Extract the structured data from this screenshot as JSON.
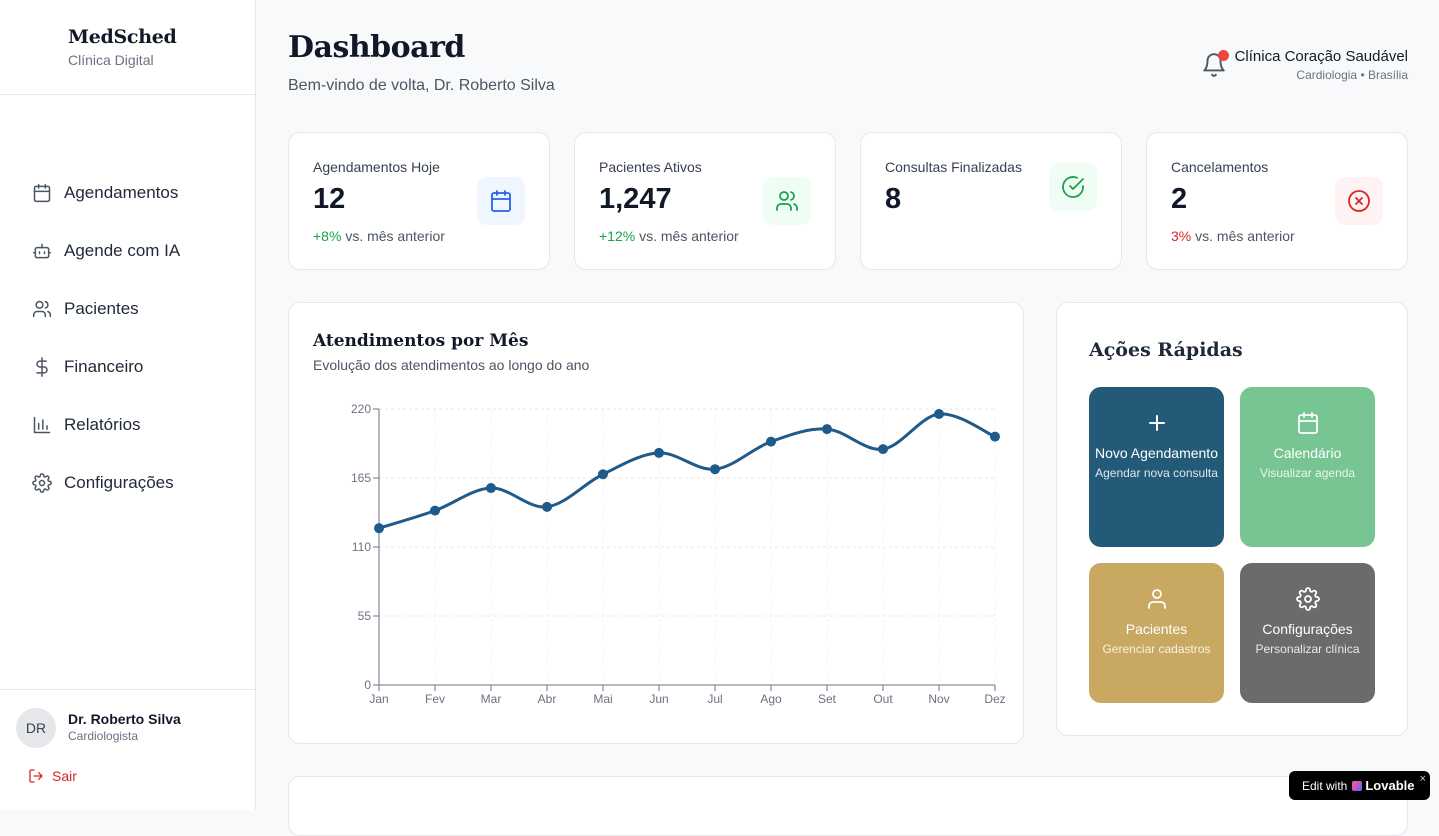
{
  "brand": {
    "name": "MedSched",
    "subtitle": "Clínica Digital"
  },
  "nav": {
    "items": [
      {
        "label": "Agendamentos",
        "icon": "calendar-icon"
      },
      {
        "label": "Agende com IA",
        "icon": "robot-icon"
      },
      {
        "label": "Pacientes",
        "icon": "users-icon"
      },
      {
        "label": "Financeiro",
        "icon": "dollar-icon"
      },
      {
        "label": "Relatórios",
        "icon": "bar-chart-icon"
      },
      {
        "label": "Configurações",
        "icon": "gear-icon"
      }
    ]
  },
  "user": {
    "initials": "DR",
    "name": "Dr. Roberto Silva",
    "role": "Cardiologista",
    "logout_label": "Sair"
  },
  "header": {
    "title": "Dashboard",
    "welcome": "Bem-vindo de volta, Dr. Roberto Silva",
    "clinic_name": "Clínica Coração Saudável",
    "clinic_sub": "Cardiologia • Brasília"
  },
  "stats": [
    {
      "label": "Agendamentos Hoje",
      "value": "12",
      "change": "+8%",
      "change_text": "vs. mês anterior",
      "trend": "up",
      "icon": "calendar-icon",
      "color": "#2563eb",
      "bg": "#eff6ff"
    },
    {
      "label": "Pacientes Ativos",
      "value": "1,247",
      "change": "+12%",
      "change_text": "vs. mês anterior",
      "trend": "up",
      "icon": "users-icon",
      "color": "#16a34a",
      "bg": "#f0fdf4"
    },
    {
      "label": "Consultas Finalizadas",
      "value": "8",
      "change": "",
      "change_text": "",
      "trend": "",
      "icon": "check-circle-icon",
      "color": "#16a34a",
      "bg": "#f0fdf4"
    },
    {
      "label": "Cancelamentos",
      "value": "2",
      "change": "3%",
      "change_text": "vs. mês anterior",
      "trend": "down",
      "icon": "x-circle-icon",
      "color": "#dc2626",
      "bg": "#fef2f2"
    }
  ],
  "chart": {
    "title": "Atendimentos por Mês",
    "subtitle": "Evolução dos atendimentos ao longo do ano"
  },
  "chart_data": {
    "type": "line",
    "categories": [
      "Jan",
      "Fev",
      "Mar",
      "Abr",
      "Mai",
      "Jun",
      "Jul",
      "Ago",
      "Set",
      "Out",
      "Nov",
      "Dez"
    ],
    "series": [
      {
        "values": [
          125,
          139,
          157,
          142,
          168,
          185,
          172,
          194,
          204,
          188,
          216,
          198
        ],
        "color": "#1e5a8a"
      }
    ],
    "yticks": [
      0,
      55,
      110,
      165,
      220
    ],
    "ylim": [
      0,
      220
    ],
    "grid": true
  },
  "quick_actions": {
    "title": "Ações Rápidas",
    "items": [
      {
        "title": "Novo Agendamento",
        "sub": "Agendar nova consulta",
        "icon": "plus-icon",
        "bg": "#235a78"
      },
      {
        "title": "Calendário",
        "sub": "Visualizar agenda",
        "icon": "calendar-icon",
        "bg": "#77c592"
      },
      {
        "title": "Pacientes",
        "sub": "Gerenciar cadastros",
        "icon": "user-icon",
        "bg": "#c9a961"
      },
      {
        "title": "Configurações",
        "sub": "Personalizar clínica",
        "icon": "gear-icon",
        "bg": "#6b6b6b"
      }
    ]
  },
  "badge": {
    "prefix": "Edit with",
    "brand": "Lovable",
    "close": "×"
  }
}
